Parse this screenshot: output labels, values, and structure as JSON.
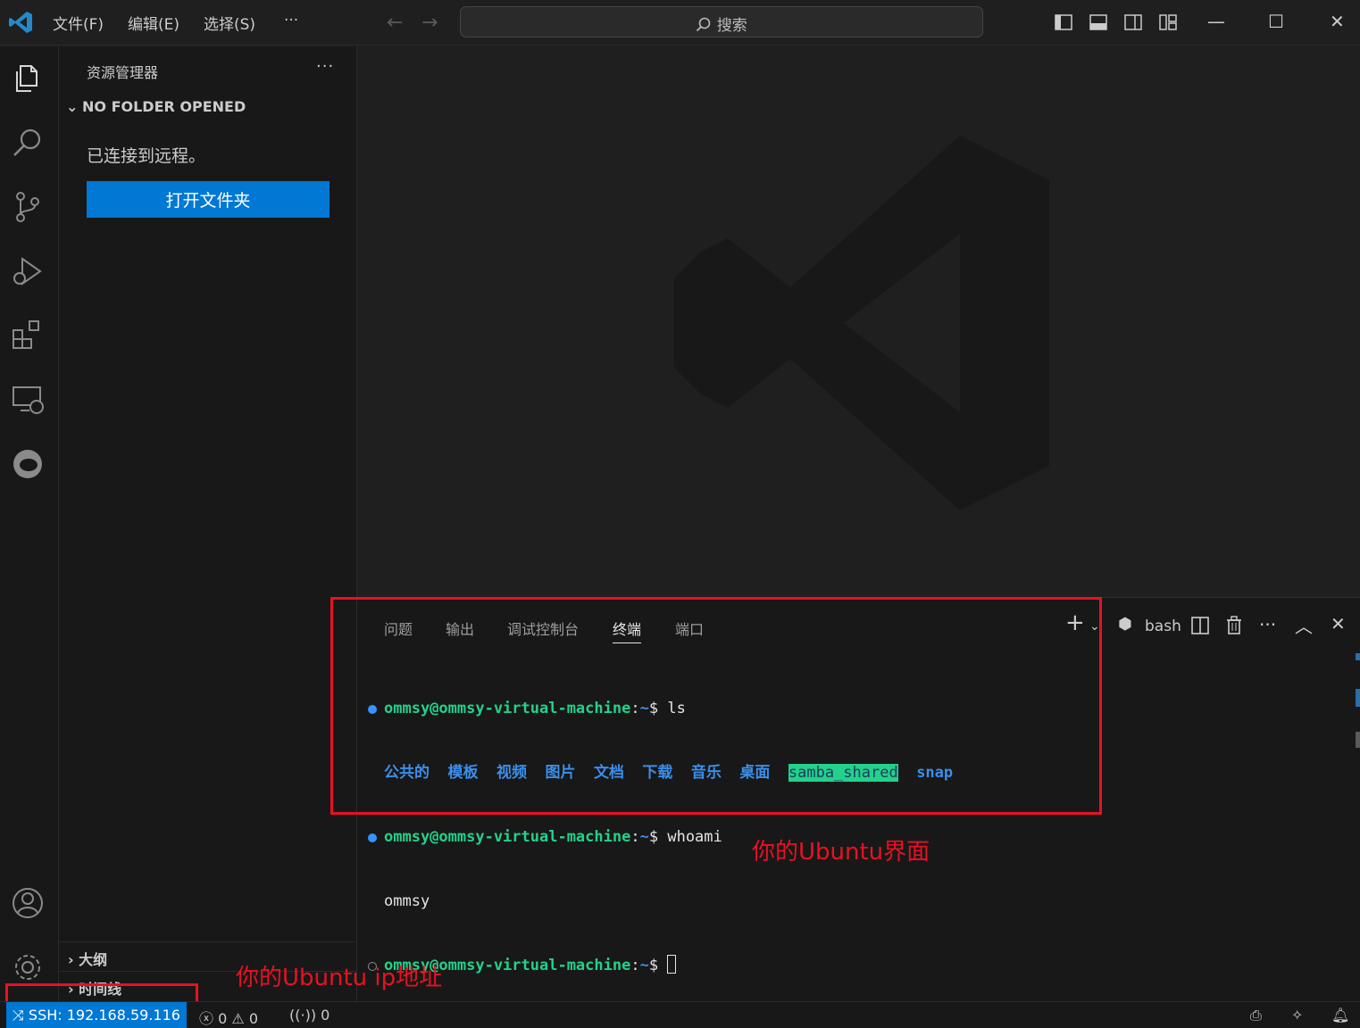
{
  "titlebar": {
    "menus": [
      "文件(F)",
      "编辑(E)",
      "选择(S)",
      "···"
    ],
    "search_label": "搜索"
  },
  "sidebar": {
    "title": "资源管理器",
    "more": "···",
    "section": "NO FOLDER OPENED",
    "message": "已连接到远程。",
    "open_folder_button": "打开文件夹",
    "outline": "大纲",
    "timeline": "时间线"
  },
  "panel": {
    "tabs": [
      "问题",
      "输出",
      "调试控制台",
      "终端",
      "端口"
    ],
    "active_tab": "终端",
    "shell_label": "bash"
  },
  "terminal": {
    "prompt_user": "ommsy@ommsy-virtual-machine",
    "prompt_path": "~",
    "prompt_symbol": "$",
    "cmd1": "ls",
    "dirs": [
      "公共的",
      "模板",
      "视频",
      "图片",
      "文档",
      "下载",
      "音乐",
      "桌面"
    ],
    "shared_dir": "samba_shared",
    "snap_dir": "snap",
    "cmd2": "whoami",
    "output2": "ommsy"
  },
  "annotations": {
    "ubuntu_ui": "你的Ubuntu界面",
    "ubuntu_ip": "你的Ubuntu ip地址"
  },
  "statusbar": {
    "remote": "SSH: 192.168.59.116",
    "errors": "0",
    "warnings": "0",
    "ports": "0"
  },
  "colors": {
    "accent": "#0078d4",
    "terminal_green": "#23d18b",
    "terminal_blue": "#3b8eea",
    "annotation_red": "#e81123"
  }
}
